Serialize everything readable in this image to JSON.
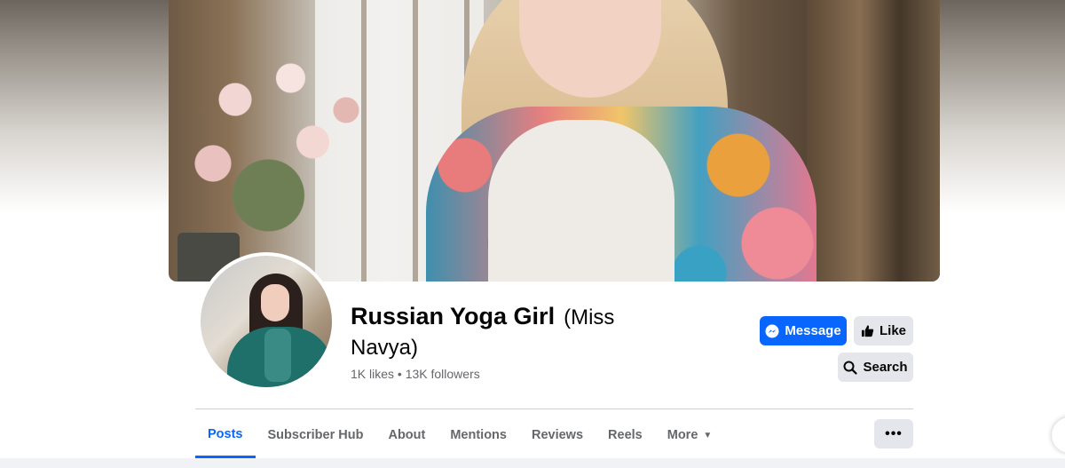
{
  "page": {
    "name": "Russian Yoga Girl",
    "alternate_name": "(Miss Navya)",
    "stats": "1K likes • 13K followers"
  },
  "actions": {
    "message_label": "Message",
    "like_label": "Like",
    "search_label": "Search"
  },
  "tabs": [
    {
      "label": "Posts",
      "active": true
    },
    {
      "label": "Subscriber Hub",
      "active": false
    },
    {
      "label": "About",
      "active": false
    },
    {
      "label": "Mentions",
      "active": false
    },
    {
      "label": "Reviews",
      "active": false
    },
    {
      "label": "Reels",
      "active": false
    },
    {
      "label": "More",
      "active": false
    }
  ],
  "icons": {
    "message": "messenger-icon",
    "like": "thumbs-up-icon",
    "search": "search-icon",
    "more_tab": "caret-down-icon",
    "overflow": "more-options-icon"
  },
  "colors": {
    "accent": "#0866ff",
    "button_gray": "#e4e6eb",
    "text_secondary": "#65676b"
  }
}
